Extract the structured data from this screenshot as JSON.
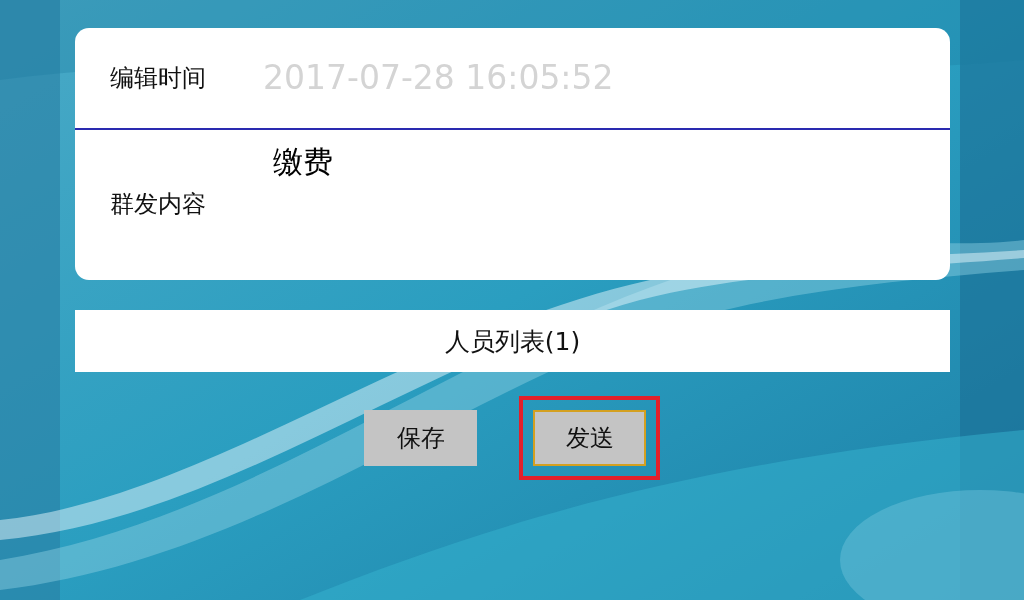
{
  "form": {
    "edit_time": {
      "label": "编辑时间",
      "placeholder": "2017-07-28 16:05:52"
    },
    "content": {
      "label": "群发内容",
      "value": "缴费"
    }
  },
  "member_list": {
    "label": "人员列表(1)"
  },
  "buttons": [
    {
      "label": "保存",
      "focused": false,
      "highlighted": false
    },
    {
      "label": "发送",
      "focused": true,
      "highlighted": true
    }
  ]
}
